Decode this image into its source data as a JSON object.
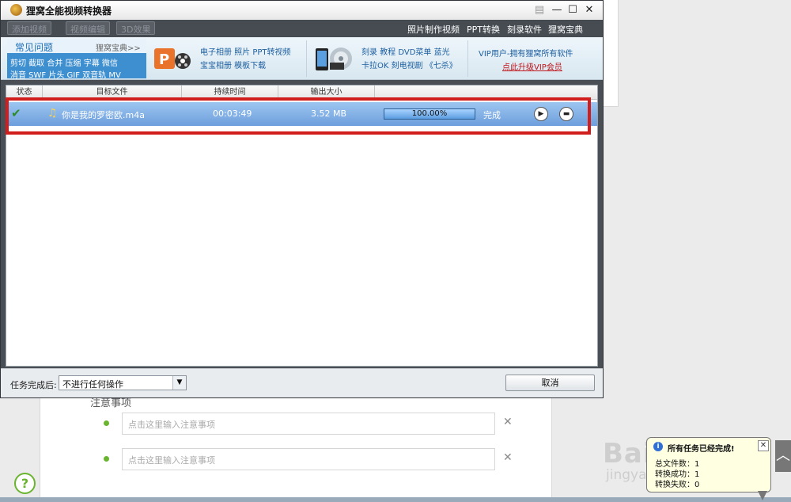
{
  "window": {
    "title": "狸窝全能视频转换器",
    "minimize_glyph": "—",
    "maximize_glyph": "☐",
    "close_glyph": "✕",
    "menu_glyph": "▤"
  },
  "toolbar": {
    "buttons": [
      "添加视频",
      "视频编辑",
      "3D效果"
    ],
    "links": [
      "照片制作视频",
      "PPT转换",
      "刻录软件",
      "狸窝宝典"
    ]
  },
  "banner": {
    "faq_title": "常见问题",
    "faq_more": "狸窝宝典>>",
    "faq_line1": "剪切 截取 合并 压缩 字幕 微信",
    "faq_line2": "消音 SWF 片头 GIF 双音轨 MV",
    "promo1_line1": "电子相册 照片 PPT转视频",
    "promo1_line2": "宝宝相册 模板下载",
    "promo2_line1": "刻录 教程 DVD菜单 蓝光",
    "promo2_line2": "卡拉OK 刻电视剧 《七杀》",
    "vip_line": "VIP用户-拥有狸窝所有软件",
    "vip_upgrade": "点此升级VIP会员"
  },
  "table": {
    "headers": [
      "状态",
      "目标文件",
      "持续时间",
      "输出大小"
    ],
    "row": {
      "status_icon": "check-icon",
      "file_name": "你是我的罗密欧.m4a",
      "duration": "00:03:49",
      "size": "3.52 MB",
      "progress_text": "100.00%",
      "progress": 1.0,
      "state": "完成"
    }
  },
  "footer": {
    "label": "任务完成后:",
    "select_value": "不进行任何操作",
    "cancel": "取消"
  },
  "background": {
    "card_title": "注意事项",
    "note_placeholder": "点击这里输入注意事项",
    "close_glyph": "✕",
    "help_glyph": "?",
    "scroll_glyph": "︿",
    "watermark": "Baidu经验",
    "watermark_sub": "jingyan.baidu.com"
  },
  "notification": {
    "title": "所有任务已经完成!",
    "line1": "总文件数：1",
    "line2": "转换成功：1",
    "line3": "转换失败：0",
    "close_glyph": "✕",
    "info_glyph": "i"
  },
  "colors": {
    "highlight": "#d21d1d",
    "row_selected": "#6d9edc",
    "vip_red": "#c0141b"
  }
}
